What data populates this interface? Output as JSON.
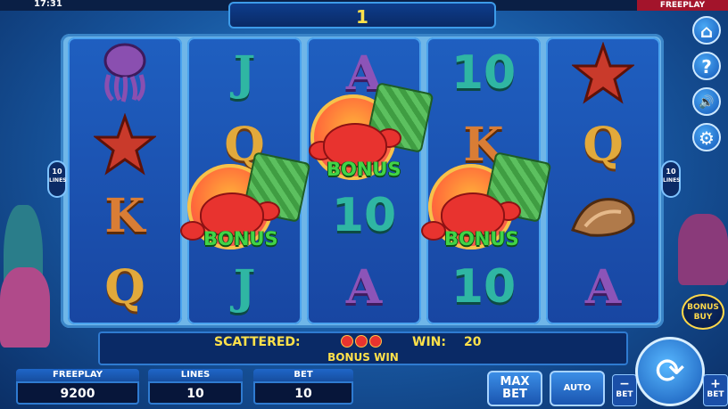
{
  "status": {
    "time": "17:31",
    "mode": "FREEPLAY"
  },
  "counter": "1",
  "lines_badge": {
    "value": "10",
    "unit": "LINES"
  },
  "reels": [
    {
      "symbols": [
        "jellyfish",
        "starfish",
        "K",
        "Q"
      ]
    },
    {
      "symbols": [
        "J",
        "Q",
        "bonus",
        "J"
      ]
    },
    {
      "symbols": [
        "A",
        "bonus",
        "10",
        "A"
      ]
    },
    {
      "symbols": [
        "10",
        "K",
        "bonus",
        "10"
      ]
    },
    {
      "symbols": [
        "starfish",
        "Q",
        "shell",
        "A"
      ]
    }
  ],
  "bonus_label": "BONUS",
  "side_buttons": [
    "home-icon",
    "help-icon",
    "sound-icon",
    "settings-icon"
  ],
  "side_glyphs": {
    "home": "⌂",
    "help": "?",
    "sound": "🔊",
    "settings": "⚙"
  },
  "bonus_buy": {
    "line1": "BONUS",
    "line2": "BUY"
  },
  "info": {
    "scattered_label": "SCATTERED:",
    "win_label": "WIN:",
    "win_value": "20",
    "bonus_win": "BONUS WIN"
  },
  "stats": {
    "freeplay": {
      "label": "FREEPLAY",
      "value": "9200"
    },
    "lines": {
      "label": "LINES",
      "value": "10"
    },
    "bet": {
      "label": "BET",
      "value": "10"
    }
  },
  "controls": {
    "max_bet_line1": "MAX",
    "max_bet_line2": "BET",
    "auto": "AUTO",
    "spin_glyph": "⟳",
    "minus_glyph": "−",
    "plus_glyph": "+",
    "bet_small": "BET"
  },
  "colors": {
    "accent": "#ffe14a",
    "bonus_text": "#41d447",
    "freeplay_tag": "#a3142b"
  }
}
